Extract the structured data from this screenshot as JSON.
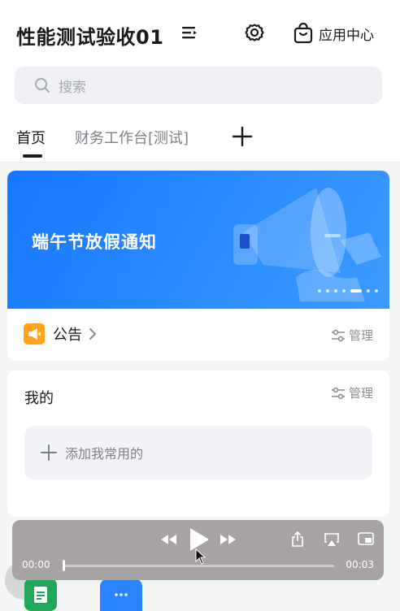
{
  "header": {
    "title": "性能测试验收01",
    "app_center_label": "应用中心"
  },
  "search": {
    "placeholder": "搜索"
  },
  "tabs": [
    {
      "label": "首页",
      "active": true
    },
    {
      "label": "财务工作台[测试]",
      "active": false
    }
  ],
  "banner": {
    "text": "端午节放假通知",
    "slide_count": 7,
    "active_slide": 6,
    "background_color": "#1677ff"
  },
  "notice": {
    "label": "公告",
    "manage_label": "管理"
  },
  "mine": {
    "title": "我的",
    "manage_label": "管理",
    "add_label": "添加我常用的"
  },
  "player": {
    "current_time": "00:00",
    "duration": "00:03",
    "progress": 0
  },
  "icons": {
    "switch": "switch-list-icon",
    "settings": "gear-icon",
    "app_center": "shopping-bag-icon",
    "search": "search-icon",
    "add_tab": "plus-icon",
    "notice": "megaphone-icon",
    "manage": "sliders-icon",
    "rewind": "rewind-icon",
    "play": "play-icon",
    "forward": "fast-forward-icon",
    "share": "share-icon",
    "airplay": "airplay-icon",
    "pip": "picture-in-picture-icon"
  }
}
